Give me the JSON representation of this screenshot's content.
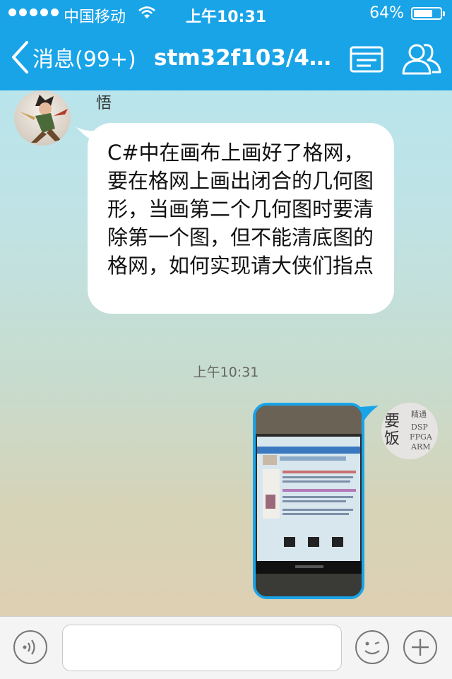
{
  "status_bar": {
    "carrier": "中国移动",
    "time": "上午10:31",
    "battery": "64%",
    "battery_level": 0.64
  },
  "header": {
    "back_label": "消息(99+)",
    "title": "stm32f103/40…"
  },
  "messages": [
    {
      "sender": "悟",
      "text": "C#中在画布上画好了格网，要在格网上画出闭合的几何图形，当画第二个几何图时要清除第一个图，但不能清底图的格网，如何实现请大侠们指点"
    },
    {
      "time": "上午10:31"
    }
  ],
  "right_avatar": {
    "line1": "精通",
    "line2": "DSP",
    "line3": "FPGA",
    "line4": "ARM",
    "big1": "要",
    "big2": "饭"
  },
  "input": {
    "placeholder": ""
  },
  "icons": [
    "back-chevron-icon",
    "menu-icon",
    "group-icon",
    "voice-icon",
    "emoji-icon",
    "plus-icon",
    "wifi-icon"
  ],
  "colors": {
    "accent": "#1aa4e8",
    "bubble": "#ffffff"
  }
}
